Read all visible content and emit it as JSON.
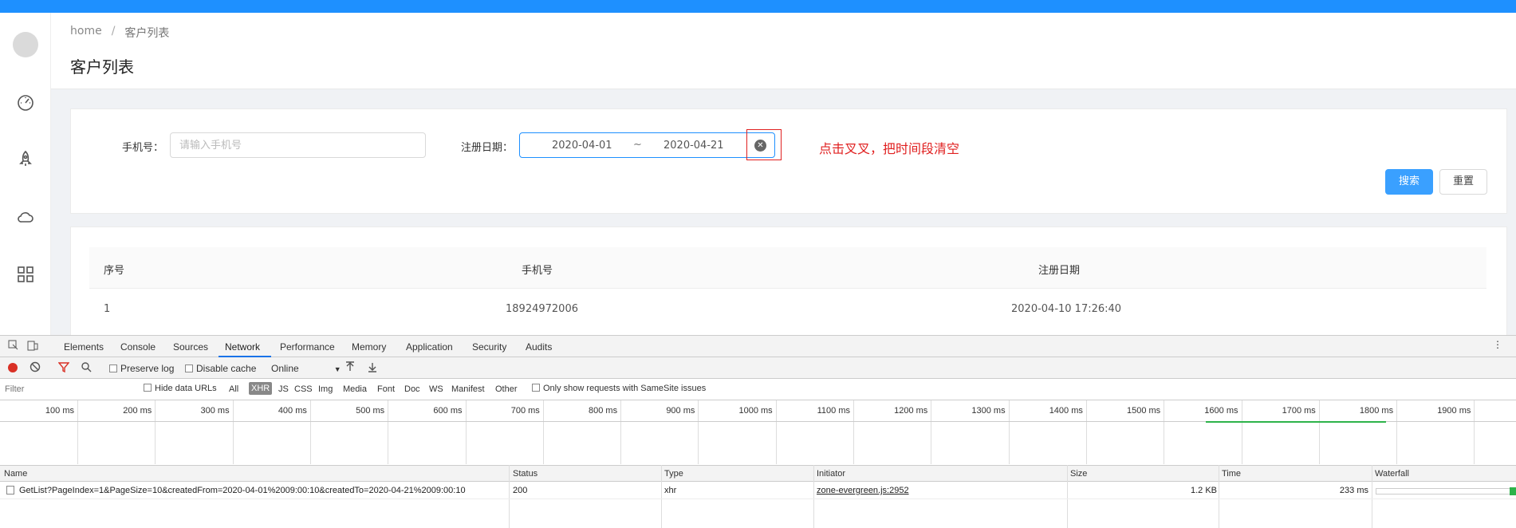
{
  "breadcrumb": {
    "home": "home",
    "separator": "/",
    "current": "客户列表"
  },
  "page": {
    "title": "客户列表"
  },
  "sidebar": {
    "items": [
      "avatar",
      "dashboard-icon",
      "rocket-icon",
      "cloud-icon",
      "grid-icon"
    ]
  },
  "filter": {
    "phone_label": "手机号：",
    "phone_placeholder": "请输入手机号",
    "date_label": "注册日期：",
    "date_from": "2020-04-01",
    "date_sep": "~",
    "date_to": "2020-04-21",
    "annotation": "点击叉叉，把时间段清空",
    "search_label": "搜索",
    "reset_label": "重置"
  },
  "table": {
    "headers": [
      "序号",
      "手机号",
      "注册日期"
    ],
    "rows": [
      {
        "index": "1",
        "phone": "18924972006",
        "date": "2020-04-10 17:26:40"
      }
    ]
  },
  "devtools": {
    "tabs": [
      "Elements",
      "Console",
      "Sources",
      "Network",
      "Performance",
      "Memory",
      "Application",
      "Security",
      "Audits"
    ],
    "active_tab": "Network",
    "toolbar": {
      "preserve_log": "Preserve log",
      "disable_cache": "Disable cache",
      "throttle": "Online"
    },
    "filter": {
      "placeholder": "Filter",
      "hide_data_urls": "Hide data URLs",
      "types": [
        "All",
        "XHR",
        "JS",
        "CSS",
        "Img",
        "Media",
        "Font",
        "Doc",
        "WS",
        "Manifest",
        "Other"
      ],
      "samesite": "Only show requests with SameSite issues"
    },
    "timeline_ticks": [
      "100 ms",
      "200 ms",
      "300 ms",
      "400 ms",
      "500 ms",
      "600 ms",
      "700 ms",
      "800 ms",
      "900 ms",
      "1000 ms",
      "1100 ms",
      "1200 ms",
      "1300 ms",
      "1400 ms",
      "1500 ms",
      "1600 ms",
      "1700 ms",
      "1800 ms",
      "1900 ms"
    ],
    "columns": [
      "Name",
      "Status",
      "Type",
      "Initiator",
      "Size",
      "Time",
      "Waterfall"
    ],
    "request": {
      "name": "GetList?PageIndex=1&PageSize=10&createdFrom=2020-04-01%2009:00:10&createdTo=2020-04-21%2009:00:10",
      "status": "200",
      "type": "xhr",
      "initiator": "zone-evergreen.js:2952",
      "size": "1.2 KB",
      "time": "233 ms"
    }
  },
  "colors": {
    "topbar": "#1e90ff",
    "primary": "#3aa0ff",
    "annotation": "#e02020",
    "waterfall": "#2db34a"
  }
}
